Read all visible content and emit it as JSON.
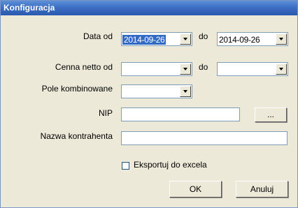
{
  "window": {
    "title": "Konfiguracja"
  },
  "form": {
    "date_from_label": "Data od",
    "date_from_value": "2014-09-26",
    "date_to_label": "do",
    "date_to_value": "2014-09-26",
    "price_from_label": "Cenna netto od",
    "price_from_value": "",
    "price_to_label": "do",
    "price_to_value": "",
    "combo_label": "Pole kombinowane",
    "combo_value": "",
    "nip_label": "NIP",
    "nip_value": "",
    "browse_label": "...",
    "contractor_label": "Nazwa kontrahenta",
    "contractor_value": "",
    "export_label": "Eksportuj do excela",
    "export_checked": false
  },
  "buttons": {
    "ok_label": "OK",
    "cancel_label": "Anuluj"
  },
  "colors": {
    "titlebar": "#3d6fc3",
    "dialog_bg": "#ece9d8",
    "selection": "#316ac5",
    "field_border": "#7f9db9"
  }
}
